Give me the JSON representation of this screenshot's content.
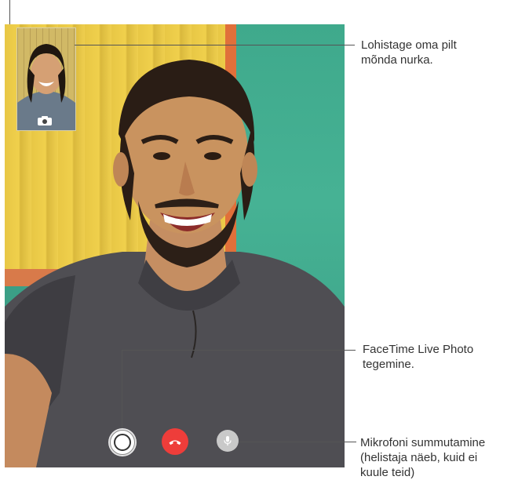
{
  "callouts": {
    "drag_pip_line1": "Lohistage oma pilt",
    "drag_pip_line2": "mõnda nurka.",
    "live_photo_line1": "FaceTime Live Photo",
    "live_photo_line2": "tegemine.",
    "mute_line1": "Mikrofoni summutamine",
    "mute_line2": "(helistaja näeb, kuid ei",
    "mute_line3": "kuule teid)"
  },
  "icons": {
    "pip_camera": "camera-icon",
    "live_photo": "shutter-icon",
    "end_call": "phone-hangup-icon",
    "mute": "microphone-icon"
  },
  "colors": {
    "end_call": "#ee3d3a",
    "mute": "#c9c9c9",
    "callout_text": "#333333"
  }
}
